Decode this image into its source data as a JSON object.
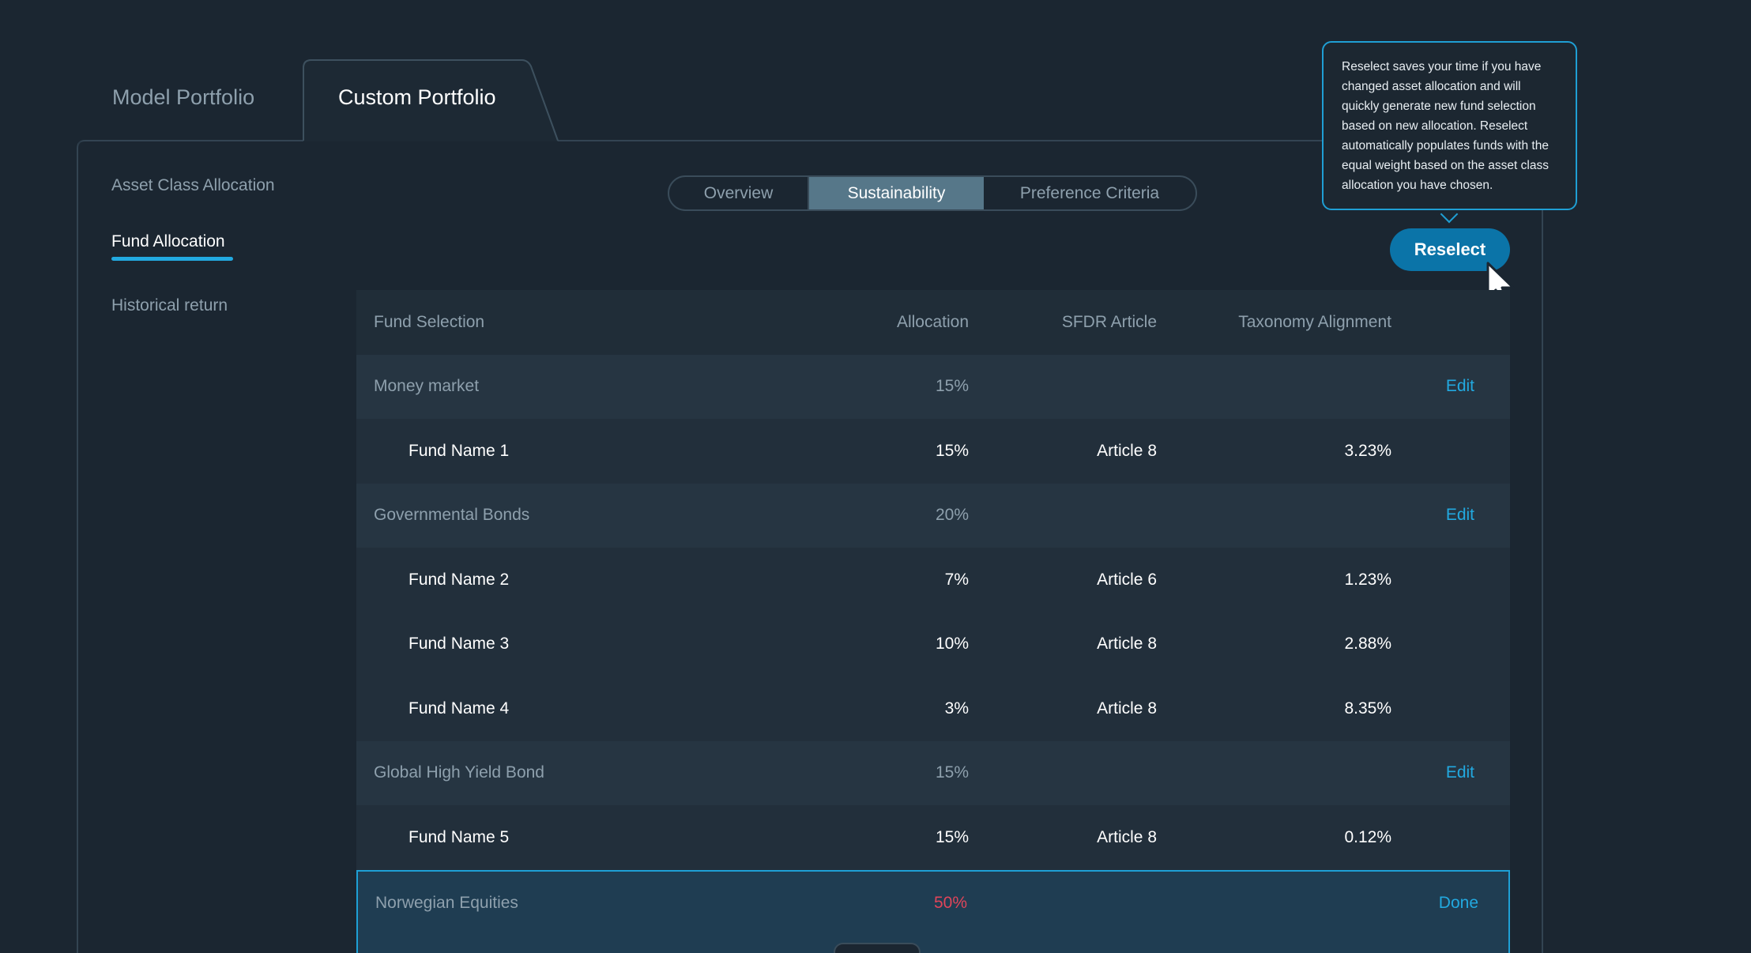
{
  "tabs": {
    "model_label": "Model Portfolio",
    "custom_label": "Custom Portfolio"
  },
  "sidenav": {
    "items": [
      {
        "label": "Asset Class Allocation"
      },
      {
        "label": "Fund Allocation"
      },
      {
        "label": "Historical return"
      }
    ],
    "active_index": 1
  },
  "segments": {
    "items": [
      {
        "label": "Overview"
      },
      {
        "label": "Sustainability"
      },
      {
        "label": "Preference Criteria"
      }
    ],
    "active_index": 1
  },
  "tooltip": {
    "text": "Reselect saves your time if you have changed asset allocation and will quickly generate new fund selection based on new allocation. Reselect automatically populates funds with the equal weight based on the asset class allocation you have chosen."
  },
  "reselect_label": "Reselect",
  "table": {
    "headers": {
      "fund_selection": "Fund Selection",
      "allocation": "Allocation",
      "sfdr": "SFDR Article",
      "taxonomy": "Taxonomy Alignment"
    },
    "groups": [
      {
        "name": "Money market",
        "allocation": "15%",
        "action": "Edit",
        "funds": [
          {
            "name": "Fund Name 1",
            "allocation": "15%",
            "sfdr": "Article 8",
            "taxonomy": "3.23%"
          }
        ]
      },
      {
        "name": "Governmental Bonds",
        "allocation": "20%",
        "action": "Edit",
        "funds": [
          {
            "name": "Fund Name 2",
            "allocation": "7%",
            "sfdr": "Article 6",
            "taxonomy": "1.23%"
          },
          {
            "name": "Fund Name 3",
            "allocation": "10%",
            "sfdr": "Article 8",
            "taxonomy": "2.88%"
          },
          {
            "name": "Fund Name 4",
            "allocation": "3%",
            "sfdr": "Article 8",
            "taxonomy": "8.35%"
          }
        ]
      },
      {
        "name": "Global High Yield Bond",
        "allocation": "15%",
        "action": "Edit",
        "funds": [
          {
            "name": "Fund Name 5",
            "allocation": "15%",
            "sfdr": "Article 8",
            "taxonomy": "0.12%"
          }
        ]
      },
      {
        "name": "Norwegian Equities",
        "allocation": "50%",
        "action": "Done",
        "funds": []
      }
    ]
  },
  "colors": {
    "background": "#1b2631",
    "accent": "#22a9e0",
    "active_segment": "#567789",
    "reselect_button": "#0b74a8",
    "warning": "#e0455a"
  }
}
